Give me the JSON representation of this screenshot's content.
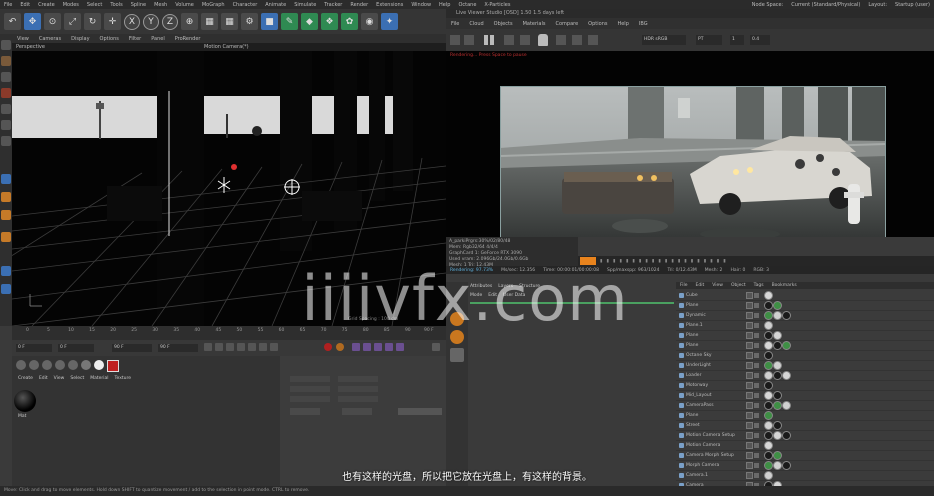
{
  "menubar": {
    "items": [
      "File",
      "Edit",
      "Create",
      "Modes",
      "Select",
      "Tools",
      "Spline",
      "Mesh",
      "Volume",
      "MoGraph",
      "Character",
      "Animate",
      "Simulate",
      "Tracker",
      "Render",
      "Extensions",
      "Window",
      "Help",
      "Octane",
      "X-Particles"
    ],
    "right": [
      "Node Space:",
      "Current (Standard/Physical)",
      "Layout:",
      "Startup (user)"
    ]
  },
  "viewport": {
    "menu": [
      "View",
      "Cameras",
      "Display",
      "Options",
      "Filter",
      "Panel",
      "ProRender"
    ],
    "label_left": "Perspective",
    "label_camera": "Motion Camera(*)",
    "grid_label": "Grid Spacing : 100 cm"
  },
  "timeline": {
    "ticks": [
      "0",
      "5",
      "10",
      "15",
      "20",
      "25",
      "30",
      "35",
      "40",
      "45",
      "50",
      "55",
      "60",
      "65",
      "70",
      "75",
      "80",
      "85",
      "90"
    ],
    "frame_end": "90 F"
  },
  "transport": {
    "field_start": "0 F",
    "field_current": "0 F",
    "field_end": "90 F",
    "field_max": "90 F"
  },
  "material_manager": {
    "menu": [
      "Create",
      "Edit",
      "View",
      "Select",
      "Material",
      "Texture"
    ],
    "material_name": "Mat"
  },
  "picture_viewer": {
    "title": "Live Viewer Studio [OSD] 1.50 1.5 days left",
    "menu": [
      "File",
      "Cloud",
      "Objects",
      "Materials",
      "Compare",
      "Options",
      "Help",
      "IBG"
    ],
    "toolbar": {
      "mode": "HDR sRGB",
      "pt": "PT",
      "val1": "1",
      "val2": "0.4"
    },
    "status_red": "Rendering... Press Space to pause"
  },
  "render_info": {
    "lines": [
      "A_parkiPrgrs:30%/02/80/48",
      "Mem:   Rgb32/64 4/4/4",
      "GraphCard 1: GeForce RTX 3090",
      "Used vram: 2.096Gb/24.0Gb/0.6Gb",
      "Mesh: 1  Tri: 12.43M"
    ],
    "rendering_label": "Rendering: 97.73%",
    "ms_sec": "Ms/sec: 12.356",
    "time": "Time: 00:00:01/00:00:08",
    "spp": "Spp/maxspp: 963/1024",
    "tri": "Tri: 0/12.43M",
    "mesh": "Mesh: 2",
    "hair": "Hair: 0",
    "rgb": "RGB: 3"
  },
  "objects_manager": {
    "menu": [
      "File",
      "Edit",
      "View",
      "Object",
      "Tags",
      "Bookmarks"
    ],
    "rows": [
      "Cube",
      "Plane",
      "Dynamic",
      "Plane.1",
      "Plane",
      "Plane",
      "Octane Sky",
      "UnderLight",
      "Loader",
      "Motorway",
      "Mid_Layout",
      "CameraPass",
      "Plane",
      "Street",
      "Motion Camera Setup",
      "Motion Camera",
      "Camera Morph Setup",
      "Morph Camera",
      "Camera.1",
      "Camera"
    ]
  },
  "left_panel": {
    "tabs": [
      "Attributes",
      "Layers",
      "Structure"
    ],
    "menu": [
      "Mode",
      "Edit",
      "User Data"
    ]
  },
  "watermark": "iiiivfx.com",
  "subtitle": "也有这样的光盘，所以把它放在光盘上，有这样的背景。",
  "statusbar": "Move: Click and drag to move elements. Hold down SHIFT to quantize movement / add to the selection in point mode. CTRL to remove."
}
